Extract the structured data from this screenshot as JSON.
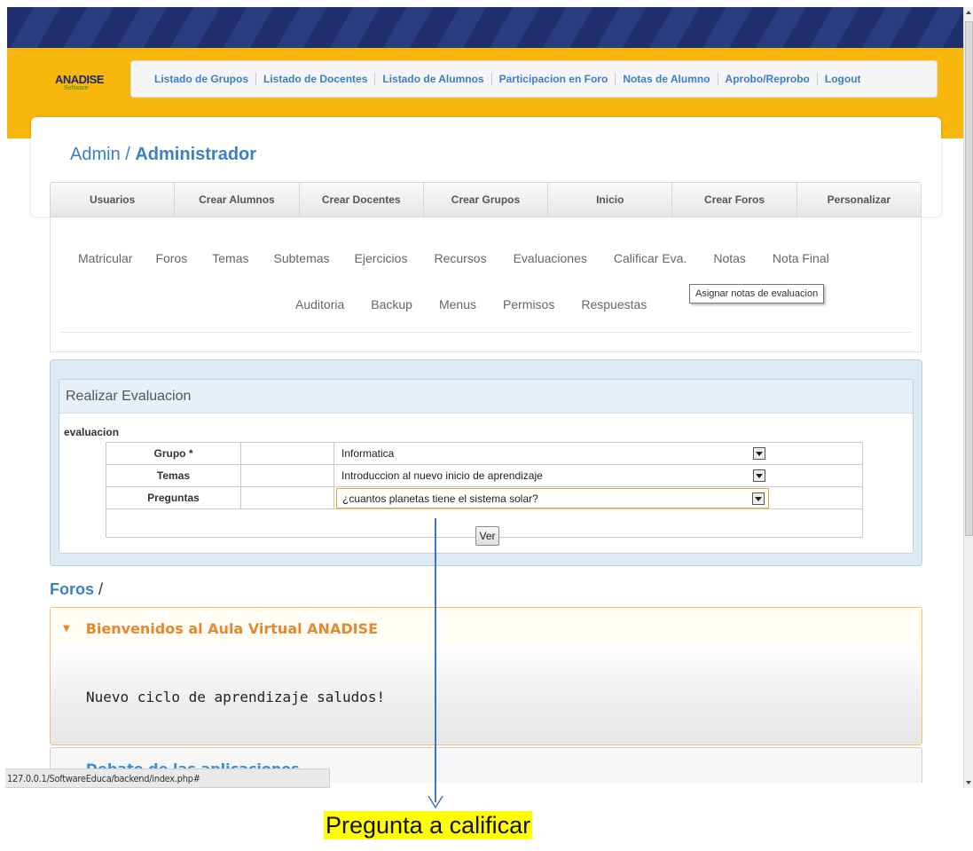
{
  "brand": {
    "logo_main": "ANADISE",
    "logo_sub": "Software",
    "colors": {
      "header_yellow": "#f7b70d",
      "header_navy": "#1f2f6b",
      "link_blue": "#3b7fc4",
      "accent_orange": "#e4892d"
    }
  },
  "topnav": {
    "items": [
      "Listado de Grupos",
      "Listado de Docentes",
      "Listado de Alumnos",
      "Participacion en Foro",
      "Notas de Alumno",
      "Aprobo/Reprobo",
      "Logout"
    ]
  },
  "breadcrumb": {
    "prefix": "Admin / ",
    "current": "Administrador"
  },
  "tabs": [
    "Usuarios",
    "Crear Alumnos",
    "Crear Docentes",
    "Crear Grupos",
    "Inicio",
    "Crear Foros",
    "Personalizar"
  ],
  "subnav": {
    "row1": [
      "Matricular",
      "Foros",
      "Temas",
      "Subtemas",
      "Ejercicios",
      "Recursos",
      "Evaluaciones",
      "Calificar Eva.",
      "Notas",
      "Nota Final"
    ],
    "row2": [
      "Auditoria",
      "Backup",
      "Menus",
      "Permisos",
      "Respuestas"
    ],
    "tooltip": "Asignar notas de evaluacion"
  },
  "evaluation": {
    "panel_title": "Realizar Evaluacion",
    "form_label": "evaluacion",
    "fields": [
      {
        "label": "Grupo *",
        "value": "Informatica"
      },
      {
        "label": "Temas",
        "value": "Introduccion al nuevo inicio de aprendizaje"
      },
      {
        "label": "Preguntas",
        "value": "¿cuantos planetas tiene el sistema solar?"
      }
    ],
    "submit_label": "Ver"
  },
  "foros": {
    "title": "Foros",
    "sep": "/",
    "items": [
      {
        "title": "Bienvenidos al Aula Virtual ANADISE",
        "body": "Nuevo ciclo de aprendizaje saludos!",
        "expanded": true
      },
      {
        "title": "Debate de las aplicaciones",
        "expanded": false
      }
    ]
  },
  "status_url": "127.0.0.1/SoftwareEduca/backend/index.php#",
  "annotation": {
    "label": "Pregunta a calificar"
  }
}
